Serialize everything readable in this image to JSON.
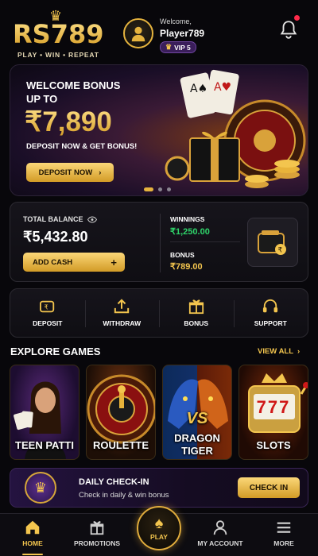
{
  "brand": {
    "logo": "RS789",
    "tagline": "PLAY • WIN • REPEAT"
  },
  "user": {
    "welcome": "Welcome,",
    "name": "Player789",
    "vip": "VIP 5"
  },
  "banner": {
    "line1": "WELCOME BONUS",
    "line2": "UP TO",
    "amount": "₹7,890",
    "subtitle": "DEPOSIT NOW & GET BONUS!",
    "cta": "DEPOSIT NOW"
  },
  "balance": {
    "label": "TOTAL BALANCE",
    "amount": "₹5,432.80",
    "add_cash": "ADD CASH",
    "winnings_label": "WINNINGS",
    "winnings": "₹1,250.00",
    "bonus_label": "BONUS",
    "bonus": "₹789.00"
  },
  "actions": [
    {
      "label": "DEPOSIT",
      "icon": "deposit-icon"
    },
    {
      "label": "WITHDRAW",
      "icon": "withdraw-icon"
    },
    {
      "label": "BONUS",
      "icon": "gift-icon"
    },
    {
      "label": "SUPPORT",
      "icon": "headset-icon"
    }
  ],
  "explore": {
    "title": "EXPLORE GAMES",
    "view_all": "VIEW ALL",
    "games": [
      {
        "label": "TEEN PATTI"
      },
      {
        "label": "ROULETTE"
      },
      {
        "label": "DRAGON\nTIGER",
        "vs": "VS"
      },
      {
        "label": "SLOTS",
        "reels": "777"
      }
    ]
  },
  "checkin": {
    "title": "DAILY CHECK-IN",
    "subtitle": "Check in daily & win bonus",
    "button": "CHECK IN"
  },
  "nav": {
    "home": "HOME",
    "promotions": "PROMOTIONS",
    "play": "PLAY",
    "account": "MY ACCOUNT",
    "more": "MORE"
  },
  "colors": {
    "accent": "#f3c54e",
    "win": "#2fd46a",
    "notify": "#ff2a4a",
    "vip": "#3a1e5a"
  }
}
